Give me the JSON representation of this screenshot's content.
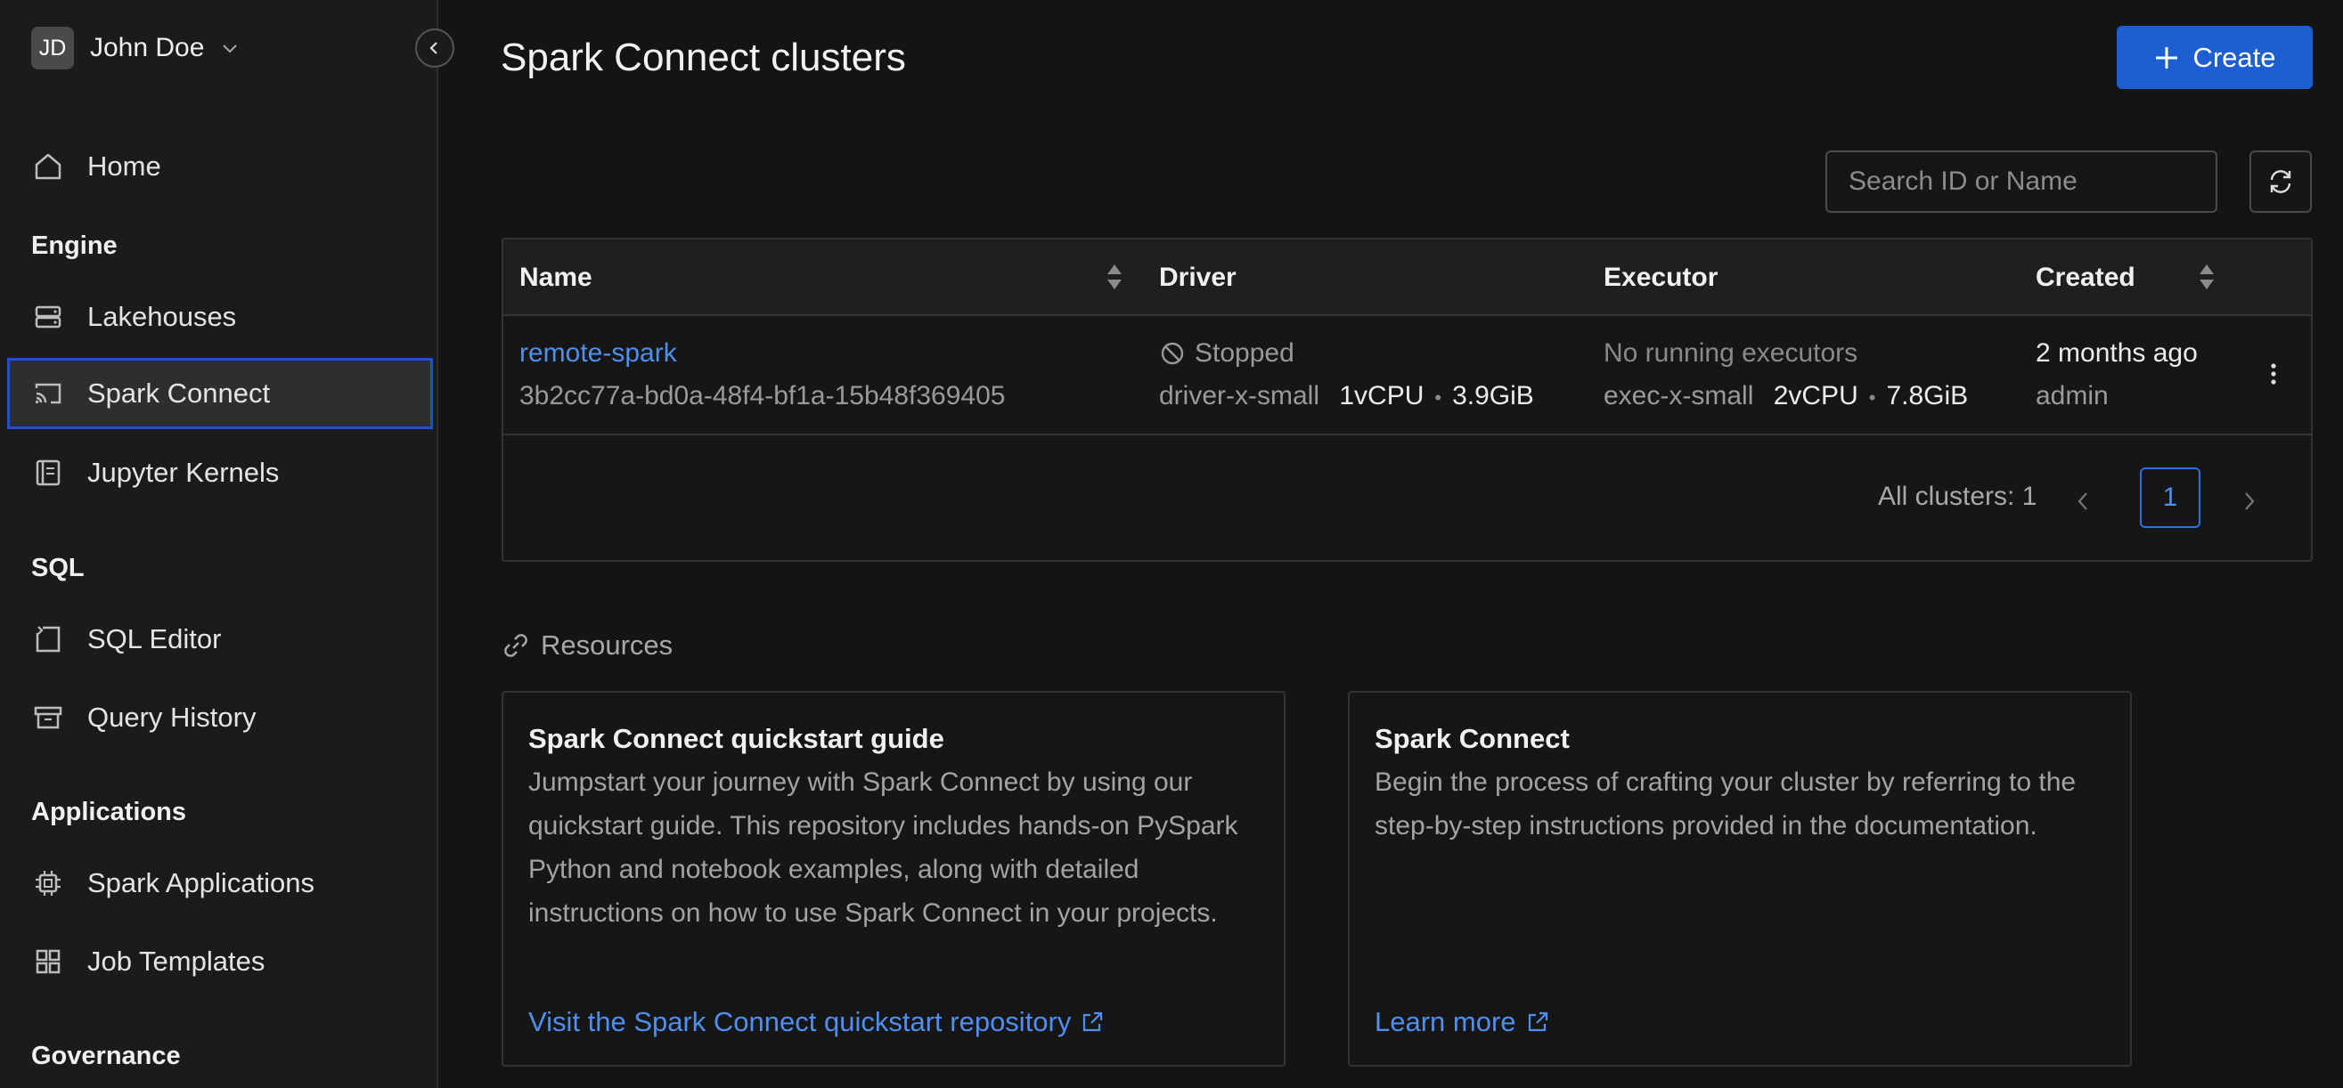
{
  "sidebar": {
    "user": {
      "initials": "JD",
      "name": "John Doe"
    },
    "items": {
      "home": "Home",
      "lakehouses": "Lakehouses",
      "spark_connect": "Spark Connect",
      "jupyter_kernels": "Jupyter Kernels",
      "sql_editor": "SQL Editor",
      "query_history": "Query History",
      "spark_applications": "Spark Applications",
      "job_templates": "Job Templates"
    },
    "sections": {
      "engine": "Engine",
      "sql": "SQL",
      "applications": "Applications",
      "governance": "Governance"
    },
    "active_item": "Spark Connect"
  },
  "header": {
    "title": "Spark Connect clusters",
    "create_label": "Create"
  },
  "search": {
    "placeholder": "Search ID or Name",
    "value": ""
  },
  "table": {
    "columns": {
      "name": "Name",
      "driver": "Driver",
      "executor": "Executor",
      "created": "Created"
    },
    "rows": [
      {
        "name": "remote-spark",
        "id": "3b2cc77a-bd0a-48f4-bf1a-15b48f369405",
        "status": "Stopped",
        "driver_size": "driver-x-small",
        "driver_cpu": "1vCPU",
        "driver_mem": "3.9GiB",
        "executor_status": "No running executors",
        "executor_size": "exec-x-small",
        "executor_cpu": "2vCPU",
        "executor_mem": "7.8GiB",
        "created": "2 months ago",
        "owner": "admin"
      }
    ],
    "pagination": {
      "total_label": "All clusters: 1",
      "current_page": "1"
    }
  },
  "resources": {
    "heading": "Resources",
    "cards": [
      {
        "title": "Spark Connect quickstart guide",
        "text": "Jumpstart your journey with Spark Connect by using our quickstart guide. This repository includes hands-on PySpark Python and notebook examples, along with detailed instructions on how to use Spark Connect in your projects.",
        "link": "Visit the Spark Connect quickstart repository"
      },
      {
        "title": "Spark Connect",
        "text": "Begin the process of crafting your cluster by referring to the step-by-step instructions provided in the documentation.",
        "link": "Learn more"
      }
    ]
  },
  "colors": {
    "accent": "#1d5fd1",
    "link": "#4e8ff0",
    "active_border": "#1f4fd8",
    "background": "#141414"
  }
}
